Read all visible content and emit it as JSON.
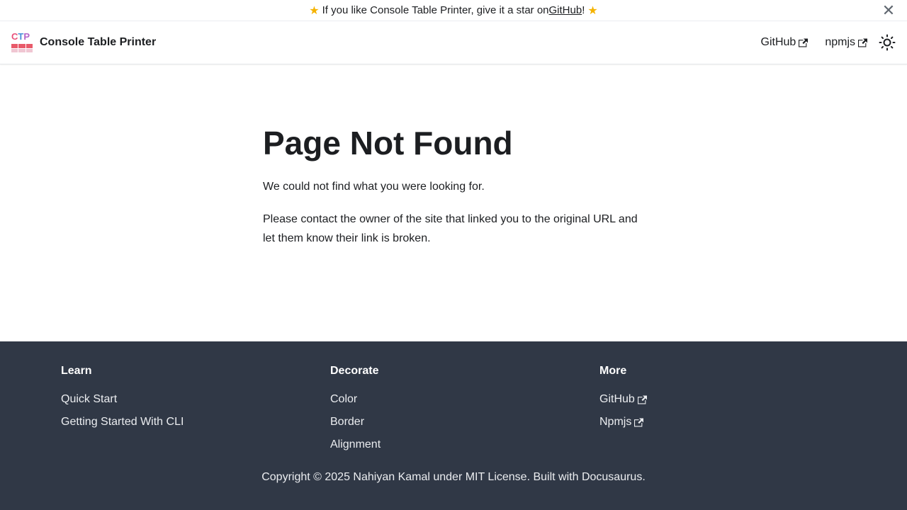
{
  "announcement": {
    "prefix": "If you like Console Table Printer, give it a star on ",
    "link_text": "GitHub",
    "suffix": "!",
    "star_icon": "star-emoji",
    "close_icon": "close-icon"
  },
  "navbar": {
    "logo_letters": [
      "C",
      "T",
      "P"
    ],
    "title": "Console Table Printer",
    "links": [
      {
        "label": "GitHub",
        "icon": "external-link-icon"
      },
      {
        "label": "npmjs",
        "icon": "external-link-icon"
      }
    ],
    "theme_icon": "sun-icon"
  },
  "main": {
    "title": "Page Not Found",
    "paragraphs": [
      "We could not find what you were looking for.",
      "Please contact the owner of the site that linked you to the original URL and let them know their link is broken."
    ]
  },
  "footer": {
    "columns": [
      {
        "title": "Learn",
        "items": [
          {
            "label": "Quick Start"
          },
          {
            "label": "Getting Started With CLI"
          }
        ]
      },
      {
        "title": "Decorate",
        "items": [
          {
            "label": "Color"
          },
          {
            "label": "Border"
          },
          {
            "label": "Alignment"
          }
        ]
      },
      {
        "title": "More",
        "items": [
          {
            "label": "GitHub",
            "external": true
          },
          {
            "label": "Npmjs",
            "external": true
          }
        ]
      }
    ],
    "copyright": "Copyright © 2025 Nahiyan Kamal under MIT License. Built with Docusaurus."
  },
  "colors": {
    "footer_bg": "#303846",
    "text": "#1c1e21",
    "star": "#f5b301"
  }
}
